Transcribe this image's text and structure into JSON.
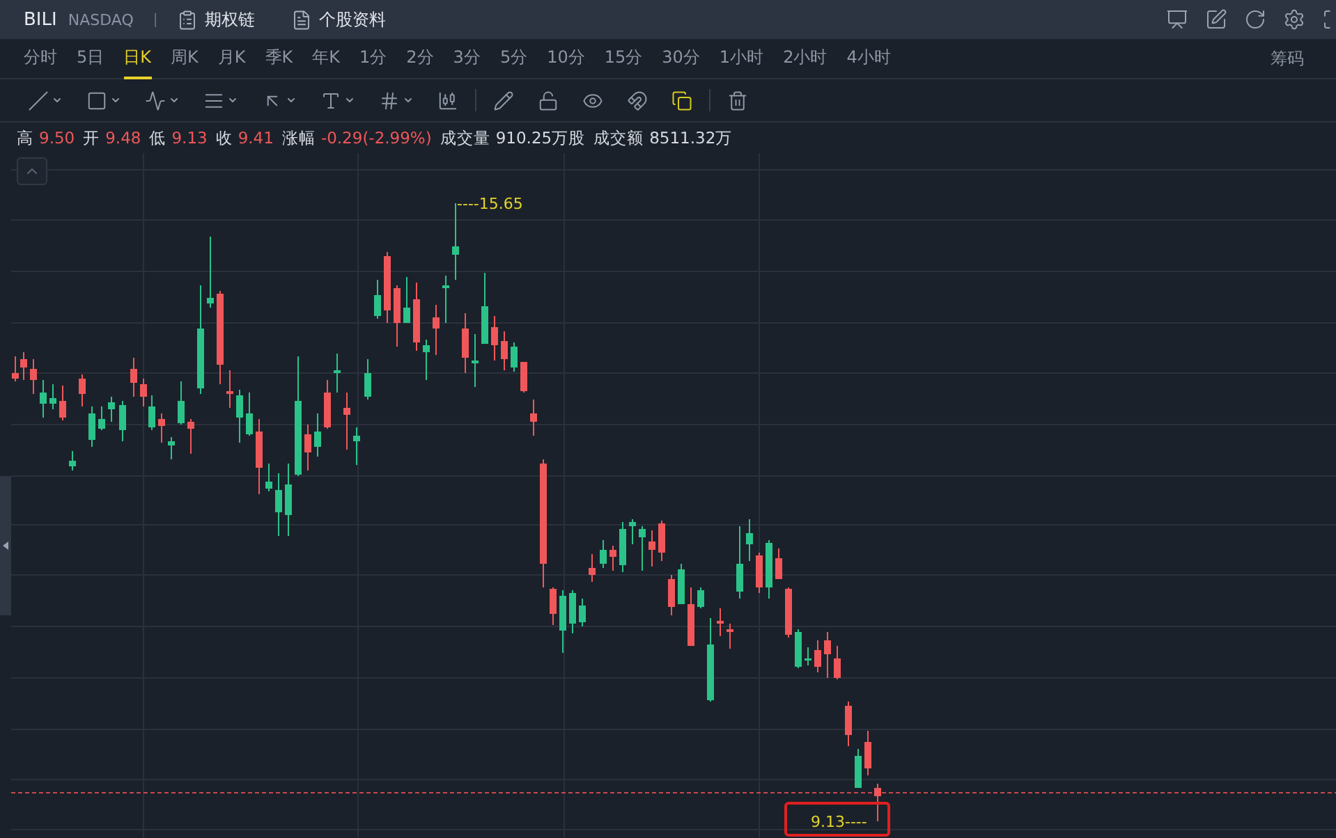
{
  "header": {
    "symbol": "BILI",
    "exchange": "NASDAQ",
    "separator": "|",
    "links": [
      {
        "label": "期权链"
      },
      {
        "label": "个股资料"
      }
    ]
  },
  "periods": [
    {
      "label": "分时",
      "selected": false
    },
    {
      "label": "5日",
      "selected": false
    },
    {
      "label": "日K",
      "selected": true
    },
    {
      "label": "周K",
      "selected": false
    },
    {
      "label": "月K",
      "selected": false
    },
    {
      "label": "季K",
      "selected": false
    },
    {
      "label": "年K",
      "selected": false
    },
    {
      "label": "1分",
      "selected": false
    },
    {
      "label": "2分",
      "selected": false
    },
    {
      "label": "3分",
      "selected": false
    },
    {
      "label": "5分",
      "selected": false
    },
    {
      "label": "10分",
      "selected": false
    },
    {
      "label": "15分",
      "selected": false
    },
    {
      "label": "30分",
      "selected": false
    },
    {
      "label": "1小时",
      "selected": false
    },
    {
      "label": "2小时",
      "selected": false
    },
    {
      "label": "4小时",
      "selected": false
    }
  ],
  "side_tab": {
    "label": "筹码"
  },
  "tool_groups": [
    [
      {
        "dropdown": true,
        "selected": false
      },
      {
        "dropdown": true,
        "selected": false
      },
      {
        "dropdown": true,
        "selected": false
      },
      {
        "dropdown": true,
        "selected": false
      },
      {
        "dropdown": true,
        "selected": false
      },
      {
        "dropdown": true,
        "selected": false
      },
      {
        "dropdown": true,
        "selected": false
      },
      {
        "dropdown": false,
        "selected": false
      }
    ],
    [
      {
        "dropdown": false,
        "selected": false
      },
      {
        "dropdown": false,
        "selected": false
      },
      {
        "dropdown": false,
        "selected": false
      },
      {
        "dropdown": false,
        "selected": false
      },
      {
        "dropdown": false,
        "selected": true
      }
    ],
    [
      {
        "dropdown": false,
        "selected": false
      }
    ]
  ],
  "stats": [
    {
      "label": "高",
      "value": "9.50",
      "kind": "down"
    },
    {
      "label": "开",
      "value": "9.48",
      "kind": "down"
    },
    {
      "label": "低",
      "value": "9.13",
      "kind": "down"
    },
    {
      "label": "收",
      "value": "9.41",
      "kind": "down"
    },
    {
      "label": "涨幅",
      "value": "-0.29(-2.99%)",
      "kind": "down"
    },
    {
      "label": "成交量",
      "value": "910.25万股",
      "kind": "plain"
    },
    {
      "label": "成交额",
      "value": "8511.32万",
      "kind": "plain"
    }
  ],
  "chart": {
    "high_label": "----15.65",
    "low_label": "9.13----",
    "low_highlighted": true
  }
}
